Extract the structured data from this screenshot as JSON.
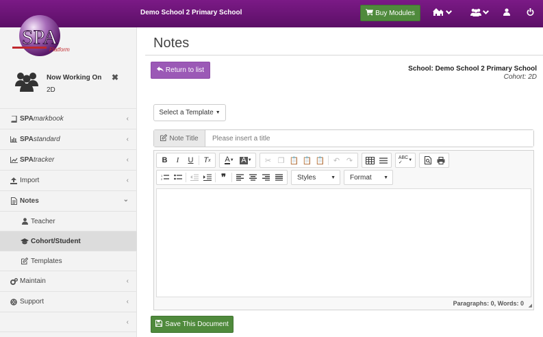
{
  "topbar": {
    "school_name": "Demo School 2 Primary School",
    "buy_modules_label": "Buy Modules",
    "icons": [
      "school-icon",
      "users-icon",
      "user-icon",
      "power-icon"
    ]
  },
  "logo": {
    "text": "SPA",
    "subtext": "Platform"
  },
  "working": {
    "label": "Now Working On",
    "cohort": "2D",
    "close": "✖"
  },
  "nav": {
    "markbook": {
      "b": "SPA",
      "i": "markbook"
    },
    "standard": {
      "b": "SPA",
      "i": "standard"
    },
    "tracker": {
      "b": "SPA",
      "i": "tracker"
    },
    "import": "Import",
    "notes": "Notes",
    "teacher": "Teacher",
    "cohort_student": "Cohort/Student",
    "templates": "Templates",
    "maintain": "Maintain",
    "support": "Support"
  },
  "main": {
    "title": "Notes",
    "return_label": "Return to list",
    "school_line": "School: Demo School 2 Primary School",
    "cohort_line": "Cohort: 2D",
    "template_label": "Select a Template",
    "note_title_label": "Note Title",
    "note_title_placeholder": "Please insert a title",
    "styles_label": "Styles",
    "format_label": "Format",
    "status_text": "Paragraphs: 0, Words: 0",
    "save_label": "Save This Document"
  },
  "colors": {
    "topbar": "#6a1577",
    "buy_green": "#4f8a3c",
    "return_purple": "#9b59b6",
    "sidebar_bg": "#f3f3f3"
  }
}
